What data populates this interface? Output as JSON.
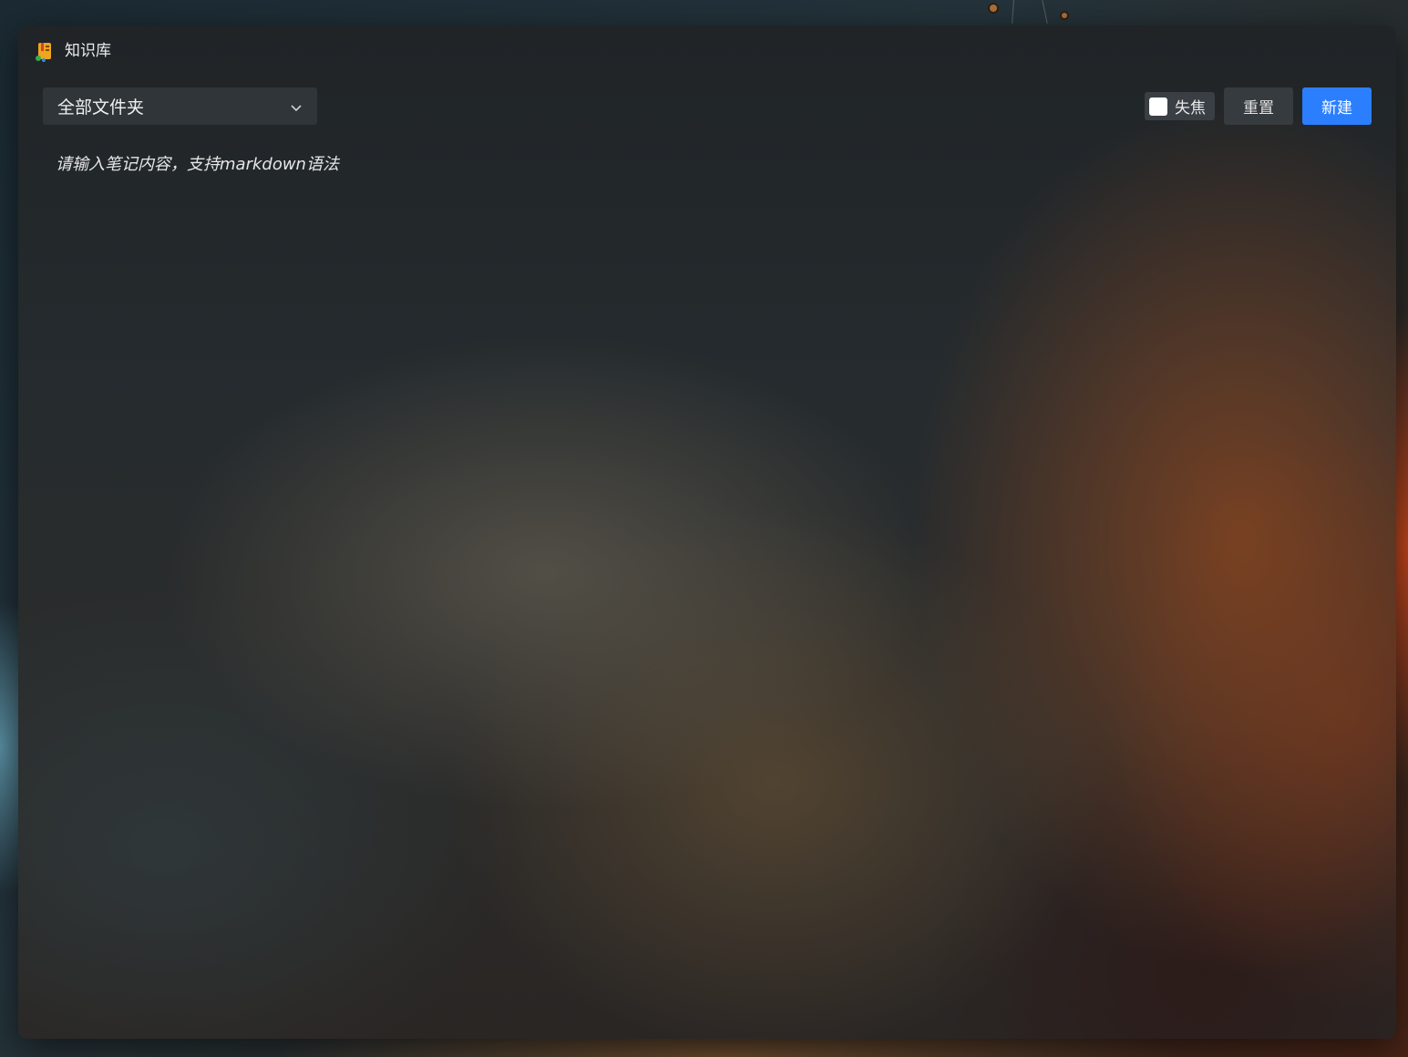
{
  "window": {
    "title": "知识库",
    "icon": "knowledge-base-app-icon"
  },
  "toolbar": {
    "folder_select": {
      "selected": "全部文件夹"
    },
    "focus_checkbox": {
      "label": "失焦",
      "checked": false
    },
    "reset_label": "重置",
    "new_label": "新建"
  },
  "editor": {
    "placeholder": "请输入笔记内容，支持markdown语法",
    "value": ""
  },
  "colors": {
    "accent": "#2b7fff",
    "window_bg": "#232729",
    "control_bg": "#30353a"
  }
}
